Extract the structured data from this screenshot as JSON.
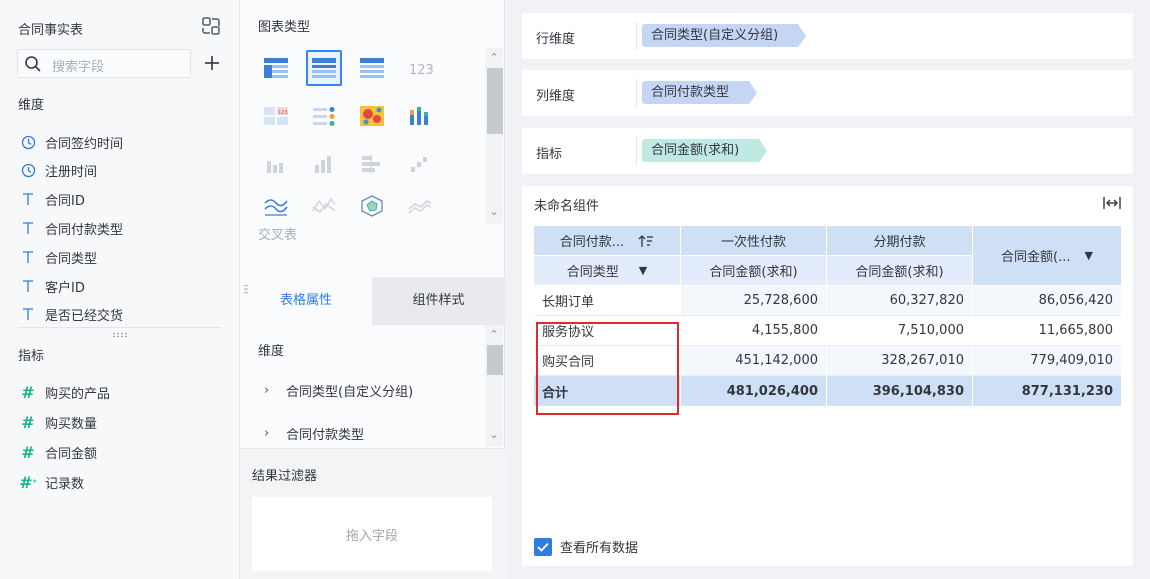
{
  "left": {
    "title": "合同事实表",
    "search_placeholder": "搜索字段",
    "dimension_label": "维度",
    "dimensions": [
      {
        "label": "合同签约时间",
        "icon": "clock-icon"
      },
      {
        "label": "注册时间",
        "icon": "clock-icon"
      },
      {
        "label": "合同ID",
        "icon": "text-type-icon"
      },
      {
        "label": "合同付款类型",
        "icon": "text-type-icon"
      },
      {
        "label": "合同类型",
        "icon": "text-type-icon"
      },
      {
        "label": "客户ID",
        "icon": "text-type-icon"
      },
      {
        "label": "是否已经交货",
        "icon": "text-type-icon"
      }
    ],
    "measure_label": "指标",
    "measures": [
      {
        "label": "购买的产品",
        "icon": "number-type-icon"
      },
      {
        "label": "购买数量",
        "icon": "number-type-icon"
      },
      {
        "label": "合同金额",
        "icon": "number-type-icon"
      },
      {
        "label": "记录数",
        "icon": "number-calc-icon"
      }
    ]
  },
  "middle": {
    "chart_type_title": "图表类型",
    "cross_table_label": "交叉表",
    "tabs": [
      "表格属性",
      "组件样式"
    ],
    "active_tab": "表格属性",
    "prop_dimension_label": "维度",
    "prop_items": [
      "合同类型(自定义分组)",
      "合同付款类型"
    ],
    "filter_title": "结果过滤器",
    "filter_drop_hint": "拖入字段"
  },
  "shelves": {
    "row": {
      "label": "行维度",
      "pill": "合同类型(自定义分组)"
    },
    "column": {
      "label": "列维度",
      "pill": "合同付款类型"
    },
    "measure": {
      "label": "指标",
      "pill": "合同金额(求和)"
    }
  },
  "widget": {
    "title": "未命名组件",
    "header": {
      "col_dim_label": "合同付款...",
      "row_dim_label": "合同类型",
      "col_groups": [
        "一次性付款",
        "分期付款"
      ],
      "measure_label": "合同金额(求和)",
      "total_col_label": "合同金额(..."
    },
    "rows": [
      {
        "label": "长期订单",
        "values": [
          "25,728,600",
          "60,327,820",
          "86,056,420"
        ]
      },
      {
        "label": "服务协议",
        "values": [
          "4,155,800",
          "7,510,000",
          "11,665,800"
        ]
      },
      {
        "label": "购买合同",
        "values": [
          "451,142,000",
          "328,267,010",
          "779,409,010"
        ]
      }
    ],
    "total": {
      "label": "合计",
      "values": [
        "481,026,400",
        "396,104,830",
        "877,131,230"
      ]
    },
    "view_all_label": "查看所有数据",
    "view_all_checked": true
  },
  "colors": {
    "accent": "#2f7de1",
    "dimension_pill": "#c5d6f5",
    "measure_pill": "#bfe9e2",
    "header_bg": "#cfdff6",
    "highlight_box": "#e02b2b"
  }
}
